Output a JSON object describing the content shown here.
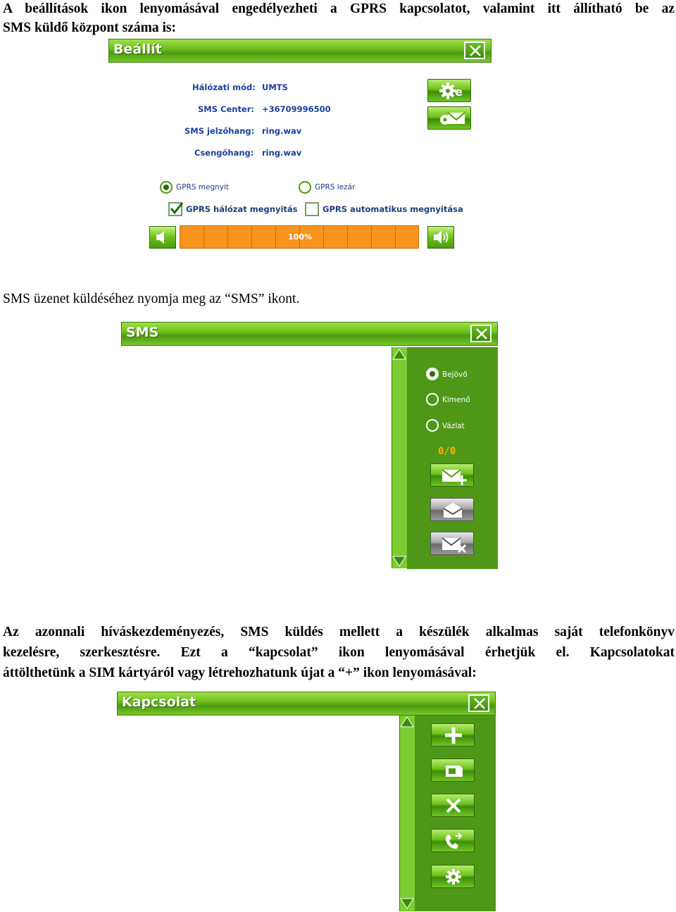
{
  "text": {
    "p1": "A beállítások ikon lenyomásával engedélyezheti a GPRS kapcsolatot, valamint itt állítható be az SMS küldő központ száma is:",
    "p1_line1": "A beállítások ikon lenyomásával engedélyezheti a GPRS kapcsolatot, valamint itt állítható be az",
    "p1_line2": "SMS küldő központ száma is:",
    "p2": "SMS üzenet küldéséhez nyomja meg az “SMS” ikont.",
    "p3_line1": "Az azonnali híváskezdeményezés, SMS küldés mellett a készülék alkalmas saját telefonkönyv",
    "p3_line2": "kezelésre, szerkesztésre. Ezt a “kapcsolat” ikon lenyomásával érhetjük el. Kapcsolatokat",
    "p3_line3": "áttölthetünk a SIM kártyáról vagy létrehozhatunk újat a “+” ikon lenyomásával:"
  },
  "settings": {
    "title": "Beállít",
    "rows": [
      {
        "label": "Hálózati mód:",
        "value": "UMTS"
      },
      {
        "label": "SMS Center:",
        "value": "+36709996500"
      },
      {
        "label": "SMS jelzőhang:",
        "value": "ring.wav"
      },
      {
        "label": "Csengőhang:",
        "value": "ring.wav"
      }
    ],
    "radio_open": "GPRS megnyit",
    "radio_close": "GPRS lezár",
    "check_network": "GPRS hálózat megnyitás",
    "check_auto": "GPRS automatikus megnyitása",
    "volume_pct": "100%",
    "volume_level": 1.0,
    "icons": [
      "gear-icon",
      "envelope-settings-icon",
      "speaker-low-icon",
      "speaker-high-icon"
    ]
  },
  "sms": {
    "title": "SMS",
    "radios": [
      "Bejövő",
      "Kimenő",
      "Vázlat"
    ],
    "counter": "0/0",
    "icons": [
      "new-message-icon",
      "open-envelope-icon",
      "delete-message-icon"
    ]
  },
  "contacts": {
    "title": "Kapcsolat",
    "icons": [
      "plus-icon",
      "sim-card-icon",
      "delete-icon",
      "call-icon",
      "settings-icon"
    ]
  },
  "colors": {
    "accent": "#6fc21e",
    "volume": "#f7941d",
    "label": "#1a3f9e"
  }
}
